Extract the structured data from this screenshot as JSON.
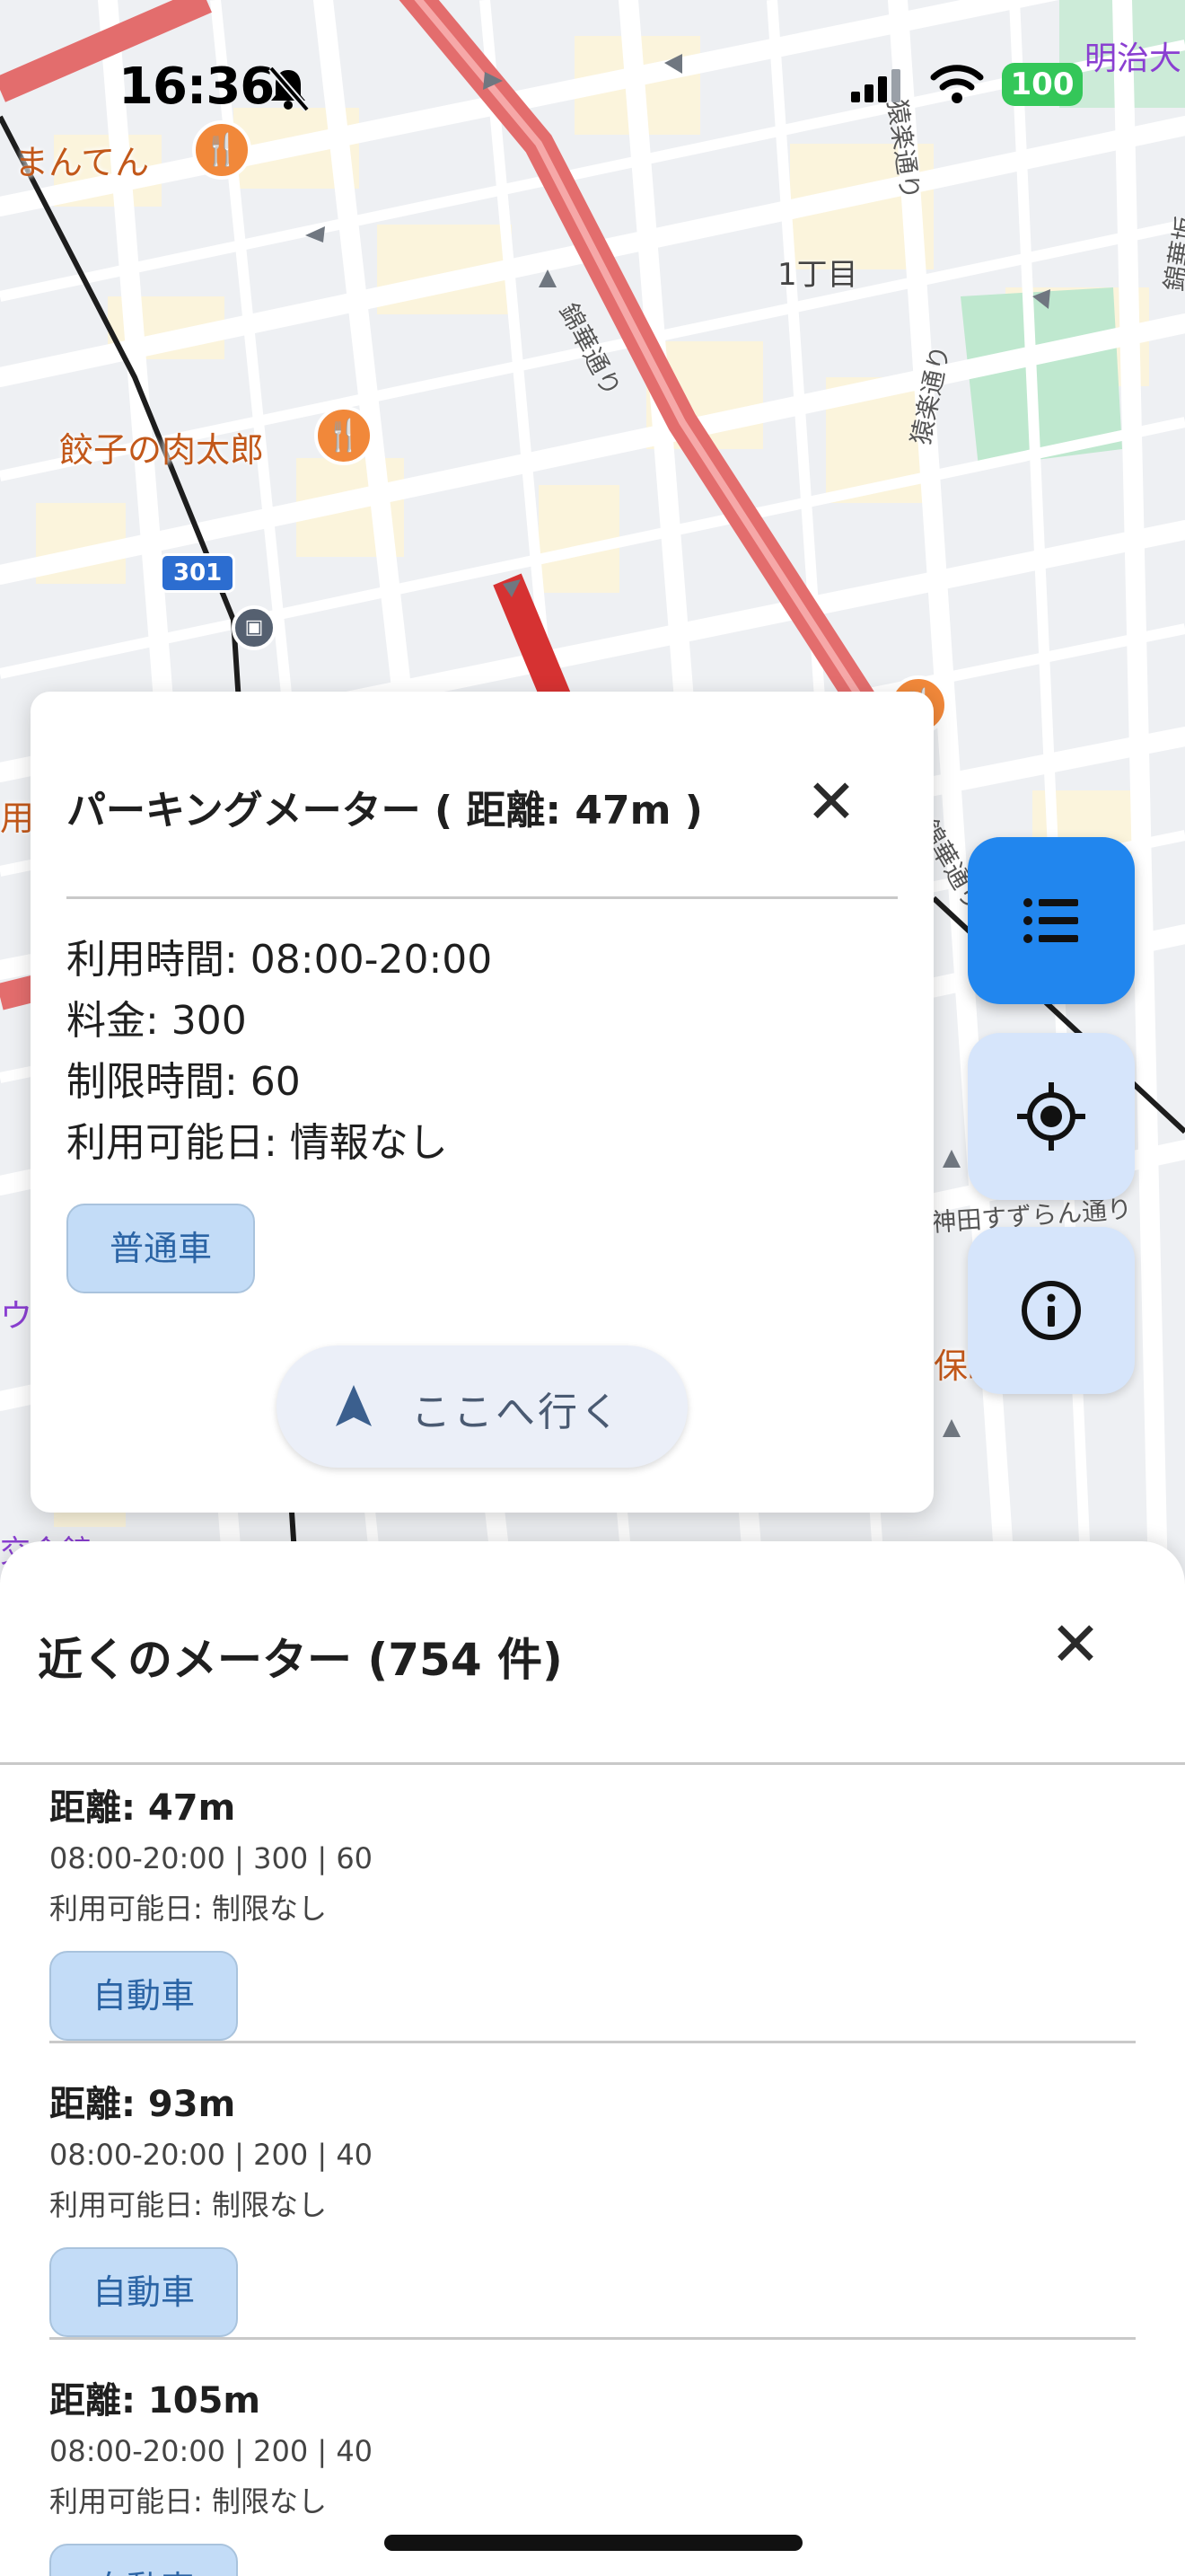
{
  "status_bar": {
    "time": "16:36",
    "battery": "100"
  },
  "map": {
    "pois": [
      {
        "label": "まんてん",
        "icon": "restaurant-icon"
      },
      {
        "label": "餃子の肉太郎",
        "icon": "restaurant-icon"
      }
    ],
    "area_label": "1丁目",
    "road_labels": [
      "錦華通り",
      "猿楽通り",
      "猿楽通り",
      "錦華坂",
      "神田すずらん通り",
      "錦華通り"
    ],
    "top_right_label": "明治大",
    "route_badge": "301",
    "fragments": [
      "用",
      "ウ",
      "保町",
      "交会館"
    ]
  },
  "detail": {
    "title": "パーキングメーター ( 距離: 47m )",
    "hours": "利用時間: 08:00-20:00",
    "fee": "料金: 300",
    "limit": "制限時間: 60",
    "days": "利用可能日: 情報なし",
    "vehicle_chip": "普通車",
    "go_label": "ここへ行く",
    "close_icon": "close-icon",
    "go_icon": "navigation-arrow-icon"
  },
  "fabs": {
    "list_icon": "list-icon",
    "locate_icon": "my-location-icon",
    "info_icon": "info-icon"
  },
  "sheet": {
    "title": "近くのメーター (754 件)",
    "items": [
      {
        "distance": "距離: 47m",
        "info": "08:00-20:00 | 300 | 60",
        "days": "利用可能日: 制限なし",
        "chip": "自動車"
      },
      {
        "distance": "距離: 93m",
        "info": "08:00-20:00 | 200 | 40",
        "days": "利用可能日: 制限なし",
        "chip": "自動車"
      },
      {
        "distance": "距離: 105m",
        "info": "08:00-20:00 | 200 | 40",
        "days": "利用可能日: 制限なし",
        "chip": "自動車"
      }
    ]
  },
  "colors": {
    "accent": "#2186ee",
    "fab_light": "#d6e5fb",
    "chip": "#c3dcf7",
    "main_road": "#e36d6d",
    "parking_highlight": "#d63232",
    "poi": "#f1883a"
  }
}
